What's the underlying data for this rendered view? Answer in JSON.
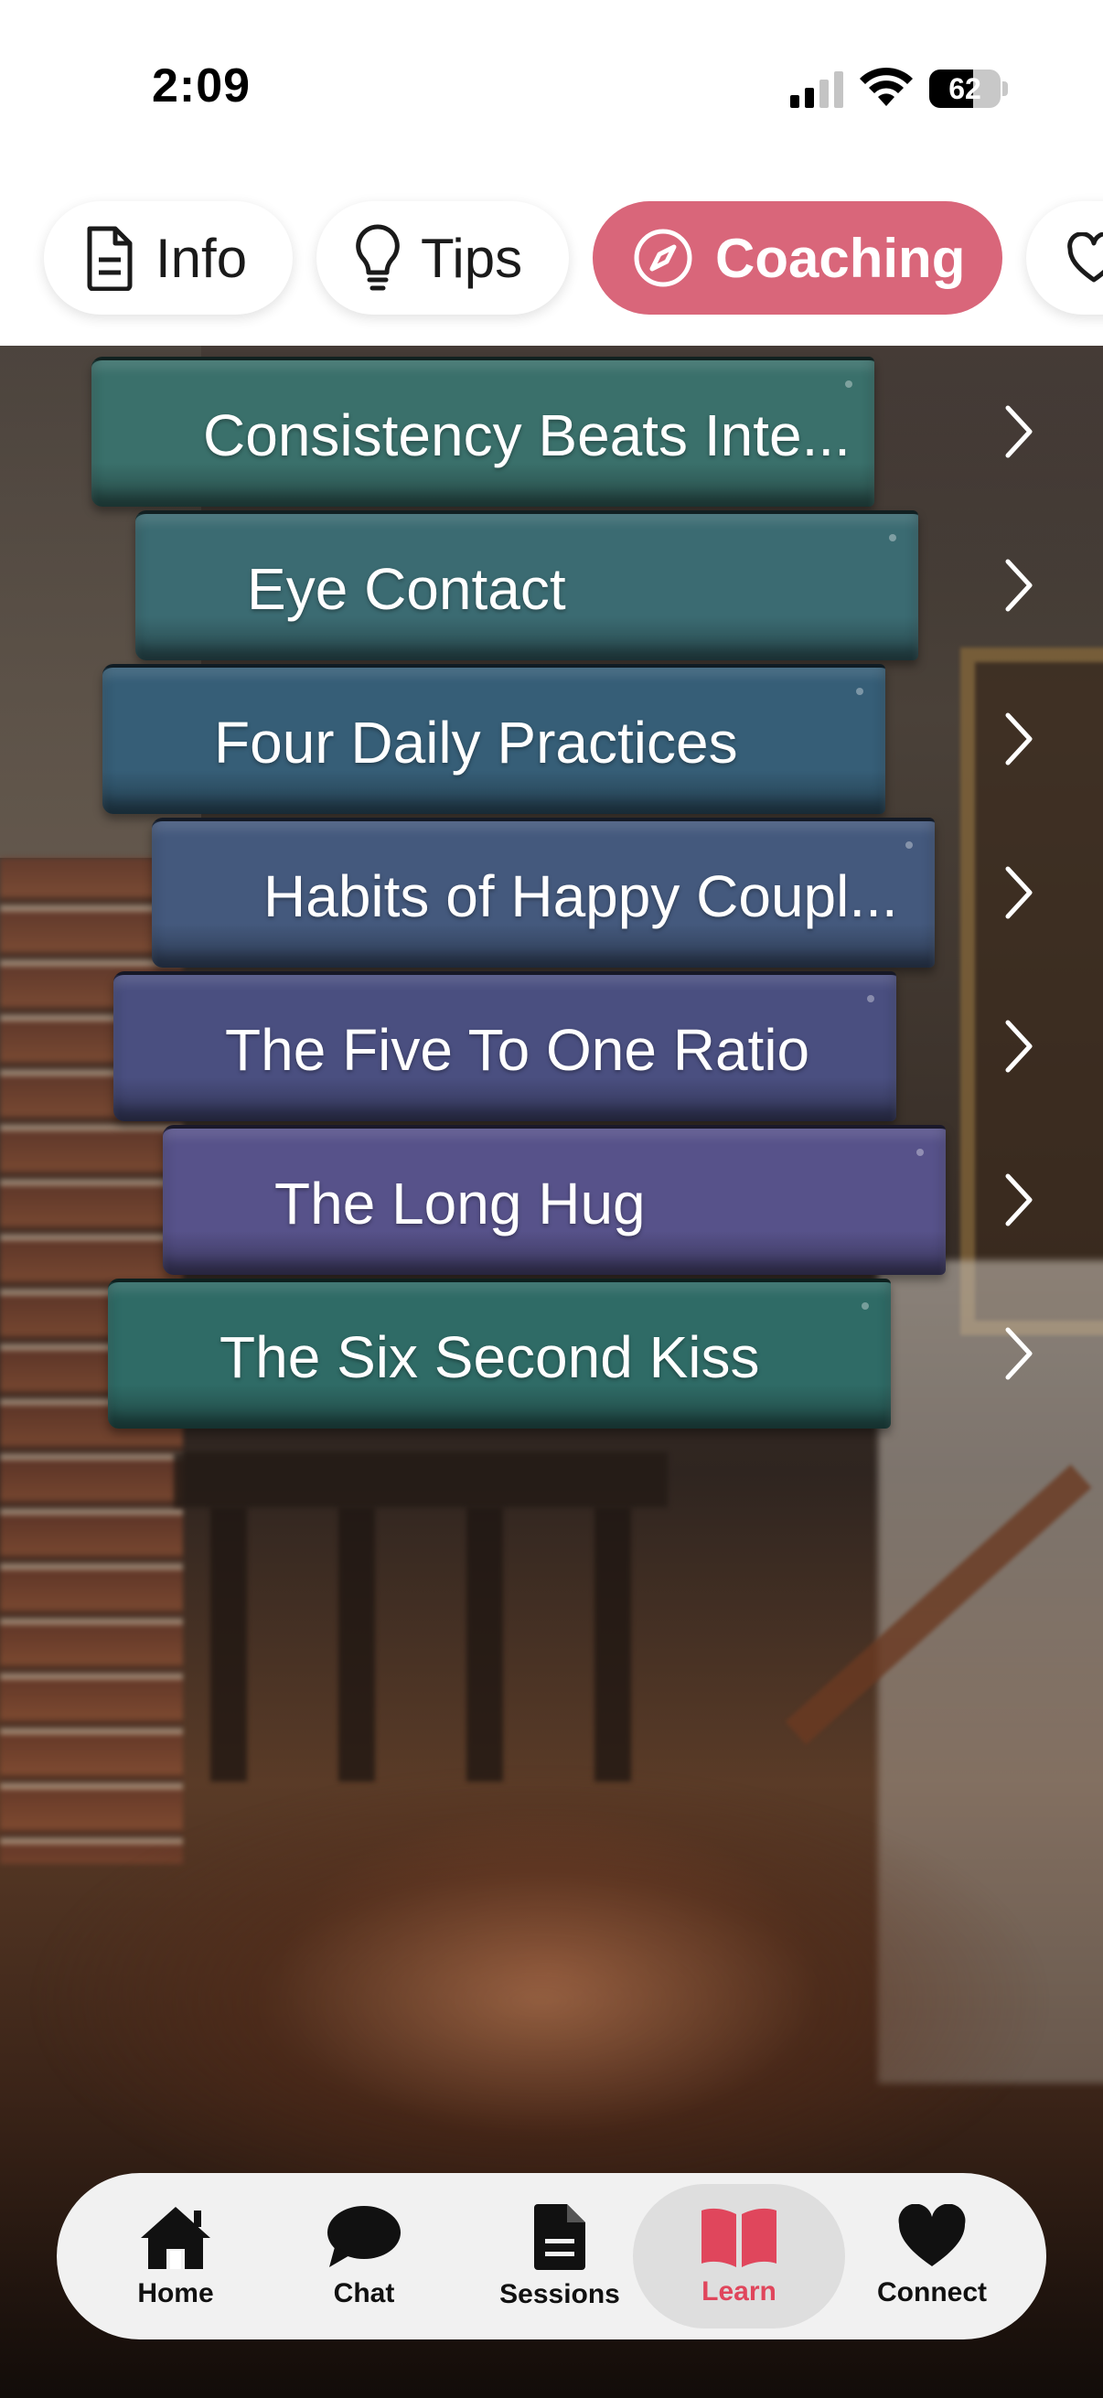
{
  "status_bar": {
    "time": "2:09",
    "battery_percent": "62",
    "battery_level": 0.62,
    "signal_bars": 2
  },
  "tabs": [
    {
      "label": "Info",
      "icon": "document-icon",
      "selected": false
    },
    {
      "label": "Tips",
      "icon": "lightbulb-icon",
      "selected": false
    },
    {
      "label": "Coaching",
      "icon": "compass-icon",
      "selected": true
    },
    {
      "label": "",
      "icon": "heart-icon",
      "selected": false
    }
  ],
  "colors": {
    "accent": "#d9667a",
    "nav_active": "#e0465c",
    "book_teal": "#2f6b68",
    "book_blue": "#365a78",
    "book_purple": "#4f4f86"
  },
  "books": [
    {
      "title": "Consistency Beats Inte...",
      "color": "#3a706b"
    },
    {
      "title": "Eye Contact",
      "color": "#3b6b72"
    },
    {
      "title": "Four Daily Practices",
      "color": "#365e77"
    },
    {
      "title": "Habits of Happy Coupl...",
      "color": "#44597d"
    },
    {
      "title": "The Five To One Ratio",
      "color": "#4a4f80"
    },
    {
      "title": "The Long Hug",
      "color": "#57528a"
    },
    {
      "title": "The Six Second Kiss",
      "color": "#2f6b66"
    }
  ],
  "bottom_nav": [
    {
      "label": "Home",
      "icon": "home-icon",
      "active": false
    },
    {
      "label": "Chat",
      "icon": "chat-bubble-icon",
      "active": false
    },
    {
      "label": "Sessions",
      "icon": "document-icon",
      "active": false
    },
    {
      "label": "Learn",
      "icon": "open-book-icon",
      "active": true
    },
    {
      "label": "Connect",
      "icon": "heart-icon",
      "active": false
    }
  ]
}
